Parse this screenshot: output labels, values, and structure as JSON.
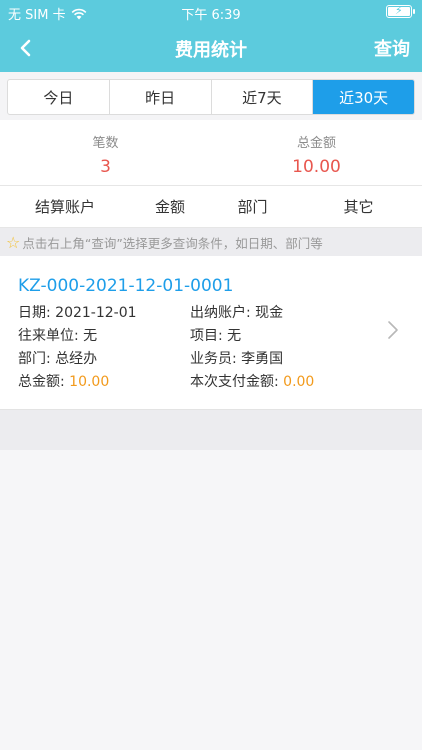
{
  "status_bar": {
    "carrier": "无 SIM 卡",
    "time": "下午 6:39"
  },
  "nav": {
    "title": "费用统计",
    "query_label": "查询"
  },
  "tabs": [
    {
      "label": "今日",
      "active": false
    },
    {
      "label": "昨日",
      "active": false
    },
    {
      "label": "近7天",
      "active": false
    },
    {
      "label": "近30天",
      "active": true
    }
  ],
  "summary": {
    "count_label": "笔数",
    "count_value": "3",
    "total_label": "总金额",
    "total_value": "10.00"
  },
  "columns": [
    "结算账户",
    "金额",
    "部门",
    "其它"
  ],
  "hint": "点击右上角“查询”选择更多查询条件，如日期、部门等",
  "record": {
    "id": "KZ-000-2021-12-01-0001",
    "date_label": "日期:",
    "date_value": "2021-12-01",
    "account_label": "出纳账户:",
    "account_value": "现金",
    "unit_label": "往来单位:",
    "unit_value": "无",
    "project_label": "项目:",
    "project_value": "无",
    "dept_label": "部门:",
    "dept_value": "总经办",
    "staff_label": "业务员:",
    "staff_value": "李勇国",
    "total_label": "总金额:",
    "total_value": "10.00",
    "paid_label": "本次支付金额:",
    "paid_value": "0.00"
  },
  "colors": {
    "header": "#5ccbdd",
    "active_tab": "#1e9ee9",
    "red": "#e8574f",
    "orange": "#f29a1c",
    "link": "#1e9ee9"
  },
  "icons": [
    "wifi-icon",
    "battery-charging-icon",
    "back-arrow-icon",
    "star-icon",
    "chevron-right-icon"
  ]
}
